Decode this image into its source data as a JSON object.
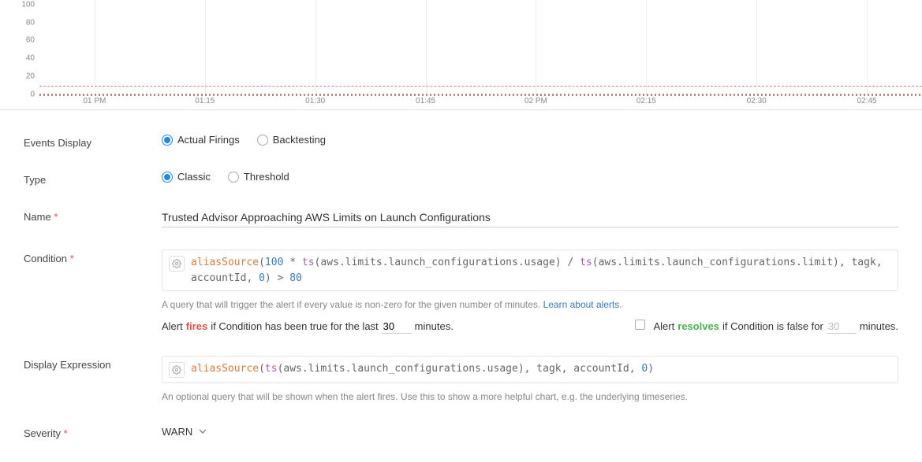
{
  "chart_data": {
    "type": "line",
    "y_ticks": [
      0,
      20,
      40,
      60,
      80,
      100
    ],
    "x_ticks": [
      "01 PM",
      "01:15",
      "01:30",
      "01:45",
      "02 PM",
      "02:15",
      "02:30",
      "02:45"
    ],
    "ylim": [
      0,
      105
    ],
    "threshold_line_value": 10,
    "baseline_value": 0
  },
  "events_display": {
    "label": "Events Display",
    "options": [
      "Actual Firings",
      "Backtesting"
    ],
    "selected": "Actual Firings"
  },
  "type_row": {
    "label": "Type",
    "options": [
      "Classic",
      "Threshold"
    ],
    "selected": "Classic"
  },
  "name_row": {
    "label": "Name",
    "required": true,
    "value": "Trusted Advisor Approaching AWS Limits on Launch Configurations"
  },
  "condition_row": {
    "label": "Condition",
    "required": true,
    "tokens": [
      {
        "t": "aliasSource",
        "c": "fn"
      },
      {
        "t": "(",
        "c": ""
      },
      {
        "t": "100",
        "c": "num"
      },
      {
        "t": " * ",
        "c": ""
      },
      {
        "t": "ts",
        "c": "kw"
      },
      {
        "t": "(aws.limits.launch_configurations.usage) / ",
        "c": ""
      },
      {
        "t": "ts",
        "c": "kw"
      },
      {
        "t": "(aws.limits.launch_configurations.limit), tagk, accountId, ",
        "c": ""
      },
      {
        "t": "0",
        "c": "num"
      },
      {
        "t": ") > ",
        "c": ""
      },
      {
        "t": "80",
        "c": "num"
      }
    ],
    "help_text": "A query that will trigger the alert if every value is non-zero for the given number of minutes. ",
    "help_link": "Learn about alerts.",
    "fires_prefix": "Alert ",
    "fires_word": "fires",
    "fires_mid": " if Condition has been true for the last ",
    "fires_value": "30",
    "fires_suffix": " minutes.",
    "resolves_prefix": "Alert ",
    "resolves_word": "resolves",
    "resolves_mid": " if Condition is false for ",
    "resolves_value": "30",
    "resolves_suffix": " minutes."
  },
  "display_expr_row": {
    "label": "Display Expression",
    "tokens": [
      {
        "t": "aliasSource",
        "c": "fn"
      },
      {
        "t": "(",
        "c": ""
      },
      {
        "t": "ts",
        "c": "kw"
      },
      {
        "t": "(aws.limits.launch_configurations.usage), tagk, accountId, ",
        "c": ""
      },
      {
        "t": "0",
        "c": "num"
      },
      {
        "t": ")",
        "c": ""
      }
    ],
    "help_text": "An optional query that will be shown when the alert fires. Use this to show a more helpful chart, e.g. the underlying timeseries."
  },
  "severity_row": {
    "label": "Severity",
    "required": true,
    "value": "WARN"
  }
}
